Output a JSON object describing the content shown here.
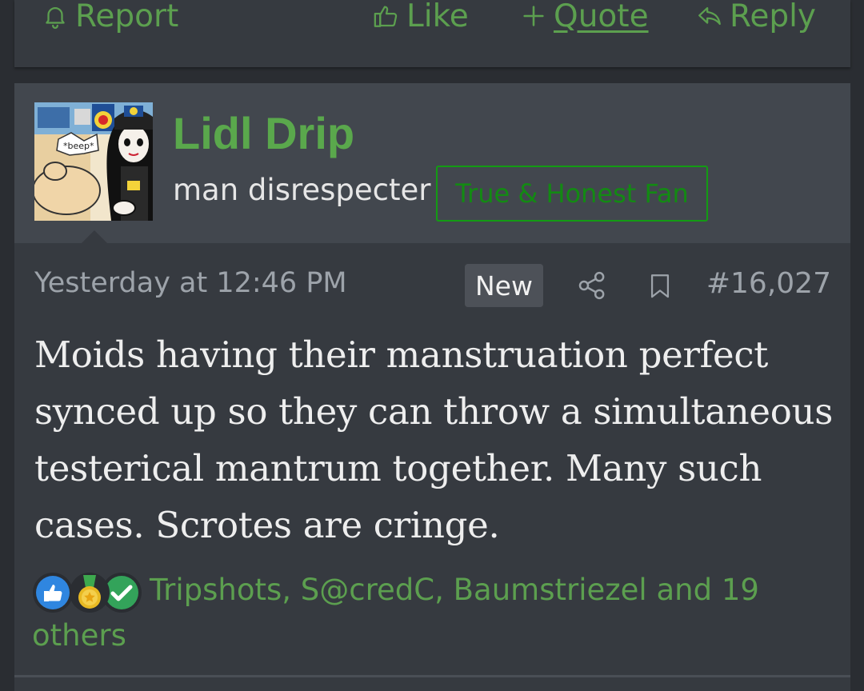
{
  "prev_post": {
    "actions": {
      "report": "Report",
      "like": "Like",
      "quote": "Quote",
      "reply": "Reply"
    }
  },
  "post": {
    "user": {
      "name": "Lidl Drip",
      "title": "man disrespecter",
      "banner": "True & Honest Fan",
      "avatar_caption": "*beep*"
    },
    "time": "Yesterday at 12:46 PM",
    "new_label": "New",
    "number": "#16,027",
    "content": "Moids having their manstruation perfect synced up so they can throw a simultaneous testerical mantrum together. Many such cases. Scrotes are cringe.",
    "reactions_text": "Tripshots, S@credC, Baumstriezel and 19 others"
  },
  "colors": {
    "accent_green": "#5c9f4f",
    "username_green": "#5aa84c",
    "banner_green": "#139b13",
    "background": "#2a2d32",
    "card": "#363a40"
  },
  "icons": [
    "bell-icon",
    "thumbs-up-icon",
    "plus-icon",
    "reply-arrow-icon",
    "share-icon",
    "bookmark-icon",
    "like-reaction-icon",
    "medal-reaction-icon",
    "check-reaction-icon"
  ]
}
